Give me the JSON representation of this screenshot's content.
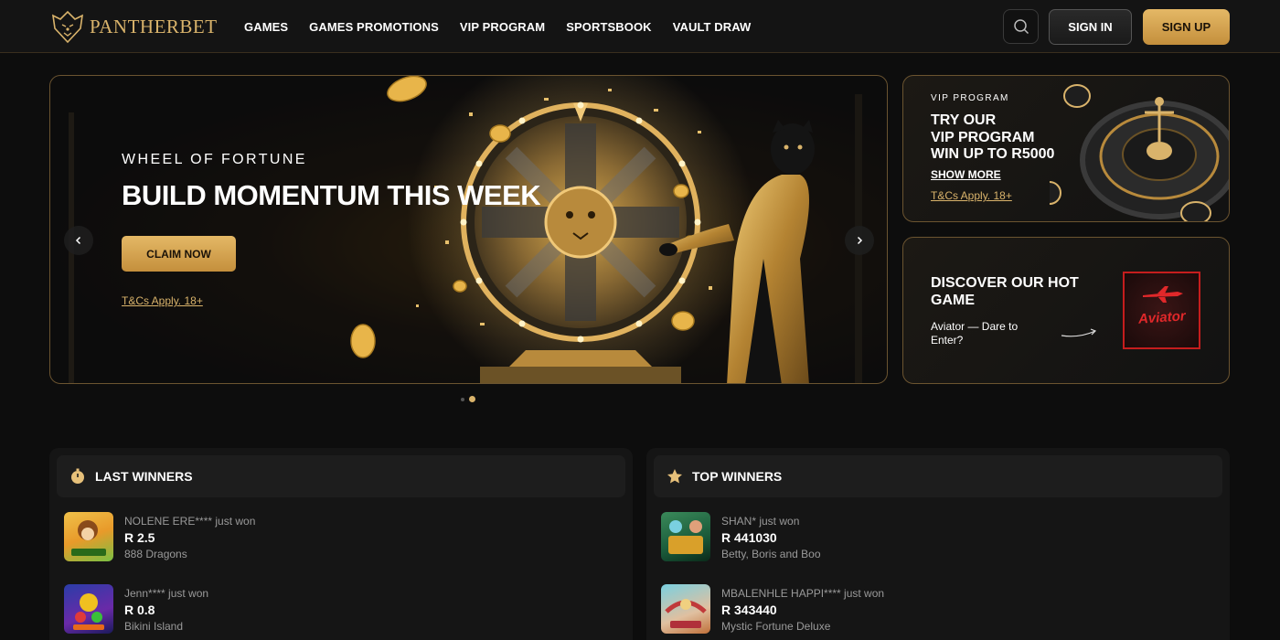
{
  "brand": {
    "name": "PANTHERBET",
    "accent": "#d9b36b"
  },
  "nav": [
    {
      "label": "GAMES"
    },
    {
      "label": "GAMES PROMOTIONS"
    },
    {
      "label": "VIP PROGRAM"
    },
    {
      "label": "SPORTSBOOK"
    },
    {
      "label": "VAULT DRAW"
    }
  ],
  "header": {
    "signin": "SIGN IN",
    "signup": "SIGN UP",
    "search_icon": "search-icon"
  },
  "hero": {
    "eyebrow": "WHEEL OF FORTUNE",
    "title": "BUILD MOMENTUM THIS WEEK",
    "cta": "CLAIM NOW",
    "tc": "T&Cs Apply. 18+",
    "slide_count": 2,
    "active_slide": 2
  },
  "vip": {
    "eyebrow": "VIP PROGRAM",
    "title_line1": "TRY OUR",
    "title_line2": "VIP PROGRAM",
    "title_line3": "WIN UP TO R5000",
    "more": "SHOW MORE",
    "tc": "T&Cs Apply. 18+"
  },
  "hot": {
    "title_line1": "DISCOVER OUR HOT",
    "title_line2": "GAME",
    "subtitle": "Aviator — Dare to Enter?",
    "thumb_label": "Aviator"
  },
  "last_winners": {
    "title": "LAST WINNERS",
    "icon": "stopwatch-icon",
    "rows": [
      {
        "who": "NOLENE ERE**** just won",
        "amount": "R 2.5",
        "game": "888 Dragons"
      },
      {
        "who": "Jenn**** just won",
        "amount": "R 0.8",
        "game": "Bikini Island"
      }
    ]
  },
  "top_winners": {
    "title": "TOP WINNERS",
    "icon": "star-icon",
    "rows": [
      {
        "who": "SHAN* just won",
        "amount": "R 441030",
        "game": "Betty, Boris and Boo"
      },
      {
        "who": "MBALENHLE HAPPI**** just won",
        "amount": "R 343440",
        "game": "Mystic Fortune Deluxe"
      }
    ]
  }
}
